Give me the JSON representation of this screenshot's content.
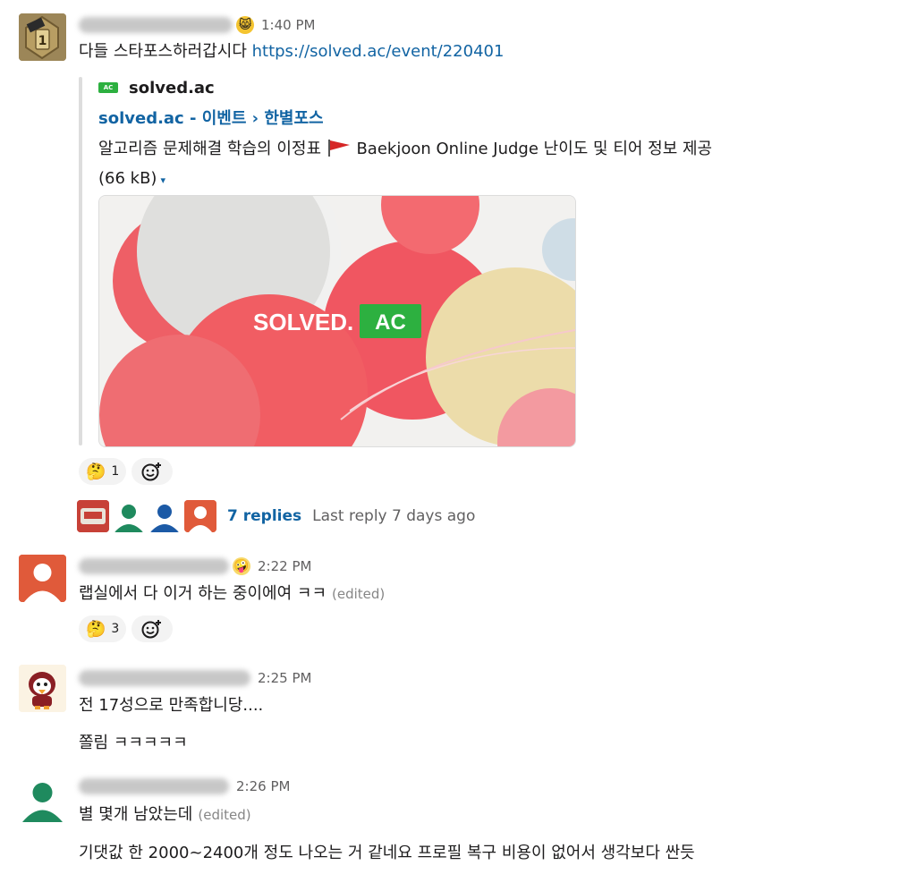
{
  "messages": [
    {
      "time": "1:40 PM",
      "text_prefix": "다들 스타포스하러갑시다 ",
      "link": "https://solved.ac/event/220401",
      "unfurl": {
        "site_icon_text": "AC",
        "site_name": "solved.ac",
        "title": "solved.ac - 이벤트 › 한별포스",
        "description_before_flag": "알고리즘 문제해결 학습의 이정표 ",
        "description_after_flag": " Baekjoon Online Judge 난이도 및 티어 정보 제공",
        "size": "(66 kB)",
        "preview_logo_left": "SOLVED.",
        "preview_logo_right": "AC"
      },
      "reactions": [
        {
          "emoji": "🤔",
          "count": "1"
        }
      ],
      "thread": {
        "replies": "7 replies",
        "last_reply": "Last reply 7 days ago"
      }
    },
    {
      "time": "2:22 PM",
      "text": "랩실에서 다 이거 하는 중이에여 ㅋㅋ",
      "edited": "(edited)",
      "reactions": [
        {
          "emoji": "🤔",
          "count": "3"
        }
      ]
    },
    {
      "time": "2:25 PM",
      "text": "전 17성으로 만족합니당....",
      "text2": "쫄림 ㅋㅋㅋㅋㅋ"
    },
    {
      "time": "2:26 PM",
      "text": "별 몇개 남았는데",
      "edited": "(edited)",
      "text2": "기댓값 한 2000~2400개 정도 나오는 거 같네요 프로필 복구 비용이 없어서 생각보다 싼듯"
    }
  ],
  "icons": {
    "add_reaction": "add-reaction-icon",
    "caret": "▾"
  },
  "colors": {
    "link": "#1264a3",
    "solved_green": "#2db040",
    "red_avatar": "#e05a3a",
    "green_avatar": "#1f8a5e",
    "blue_avatar": "#1c5aa6"
  }
}
